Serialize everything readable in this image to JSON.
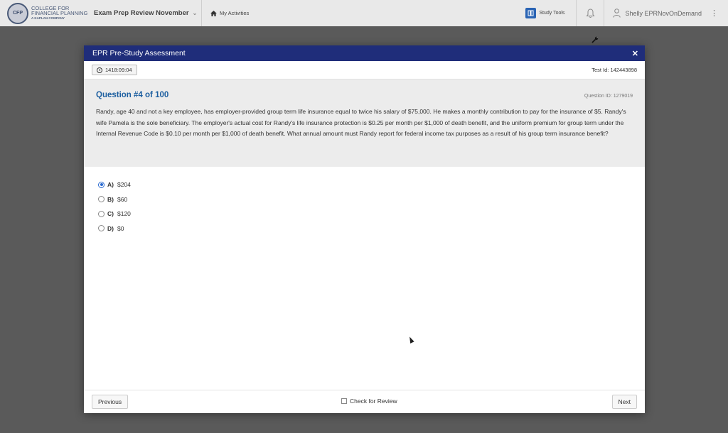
{
  "header": {
    "logo_lines": [
      "COLLEGE FOR",
      "FINANCIAL PLANNING",
      "A KAPLAN COMPANY"
    ],
    "logo_seal_text": "CFP",
    "course_title": "Exam Prep Review November",
    "activities_label": "My Activities",
    "study_tools_label": "Study Tools",
    "user_name": "Shelly EPRNovOnDemand"
  },
  "modal": {
    "title": "EPR Pre-Study Assessment",
    "timer": "1418:09:04",
    "test_id": "Test Id: 142443898",
    "question_title": "Question #4 of 100",
    "question_id": "Question ID: 1279019",
    "question_text": "Randy, age 40 and not a key employee, has employer-provided group term life insurance equal to twice his salary of $75,000. He makes a monthly contribution to pay for the insurance of $5. Randy's wife Pamela is the sole beneficiary. The employer's actual cost for Randy's life insurance protection is $0.25 per month per $1,000 of death benefit, and the uniform premium for group term under the Internal Revenue Code is $0.10 per month per $1,000 of death benefit. What annual amount must Randy report for federal income tax purposes as a result of his group term insurance benefit?",
    "options": [
      {
        "letter": "A)",
        "text": "$204",
        "selected": true
      },
      {
        "letter": "B)",
        "text": "$60",
        "selected": false
      },
      {
        "letter": "C)",
        "text": "$120",
        "selected": false
      },
      {
        "letter": "D)",
        "text": "$0",
        "selected": false
      }
    ],
    "previous_label": "Previous",
    "review_label": "Check for Review",
    "next_label": "Next"
  },
  "colors": {
    "modal_header": "#1f2d7a",
    "question_title": "#1d5fa0",
    "selected_radio": "#2a6ad0"
  }
}
